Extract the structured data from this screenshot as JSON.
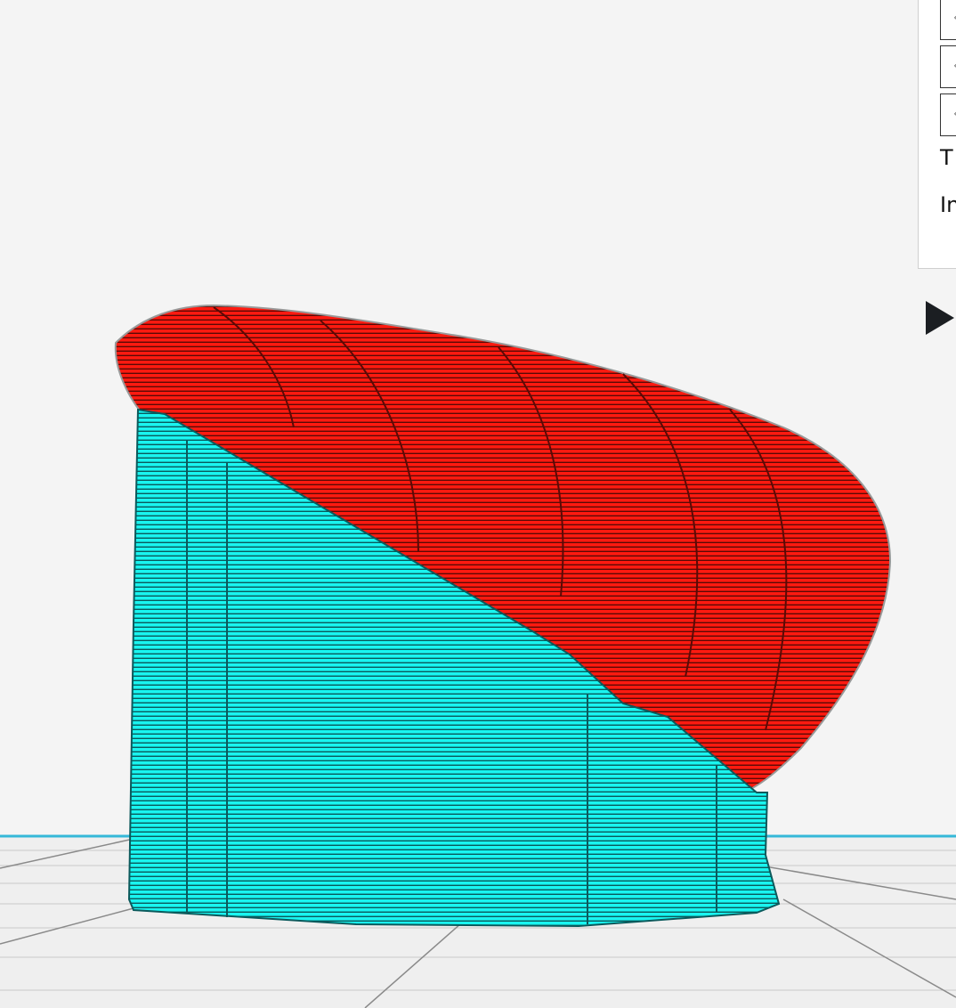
{
  "panel": {
    "fields": [
      "‹",
      "‹",
      "‹"
    ],
    "label_1": "T",
    "label_2": "In"
  },
  "colors": {
    "background": "#f4f4f4",
    "model_main": "#ff1a10",
    "support": "#19f5f0",
    "build_plate_edge": "#35b8d8"
  },
  "icons": {
    "play": "play-triangle-icon"
  }
}
